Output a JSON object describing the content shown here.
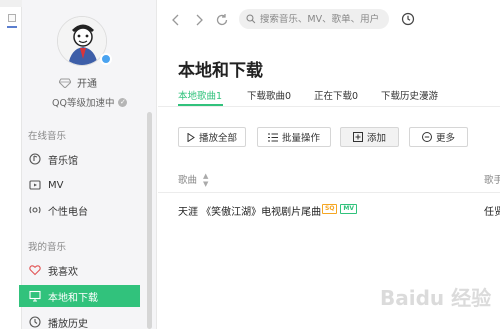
{
  "user": {
    "vip_label": "开通",
    "qq_label": "QQ等级加速中"
  },
  "sidebar": {
    "online_section": "在线音乐",
    "online_items": [
      {
        "label": "音乐馆",
        "icon": "music-hall-icon"
      },
      {
        "label": "MV",
        "icon": "mv-icon"
      },
      {
        "label": "个性电台",
        "icon": "radio-icon"
      }
    ],
    "my_section": "我的音乐",
    "my_items": [
      {
        "label": "我喜欢",
        "icon": "heart-icon"
      },
      {
        "label": "本地和下载",
        "icon": "monitor-icon"
      },
      {
        "label": "播放历史",
        "icon": "clock-icon"
      }
    ]
  },
  "topbar": {
    "back_icon": "chevron-left-icon",
    "forward_icon": "chevron-right-icon",
    "refresh_icon": "refresh-icon",
    "search_placeholder": "搜索音乐、MV、歌单、用户"
  },
  "main": {
    "title": "本地和下载",
    "tabs": [
      {
        "label": "本地歌曲1"
      },
      {
        "label": "下载歌曲0"
      },
      {
        "label": "正在下载0"
      },
      {
        "label": "下载历史漫游"
      }
    ],
    "toolbar": {
      "play_all": "播放全部",
      "batch": "批量操作",
      "add": "添加",
      "more": "更多"
    },
    "table": {
      "col_song": "歌曲",
      "col_singer": "歌手",
      "rows": [
        {
          "title": "天涯 《笑傲江湖》电视剧片尾曲",
          "tags": [
            "SQ",
            "MV"
          ],
          "singer": "任贤齐"
        }
      ]
    }
  },
  "watermark": "Baidu 经验",
  "colors": {
    "accent": "#31c27c",
    "sq_tag": "#f5a623",
    "mv_tag": "#31c27c"
  }
}
